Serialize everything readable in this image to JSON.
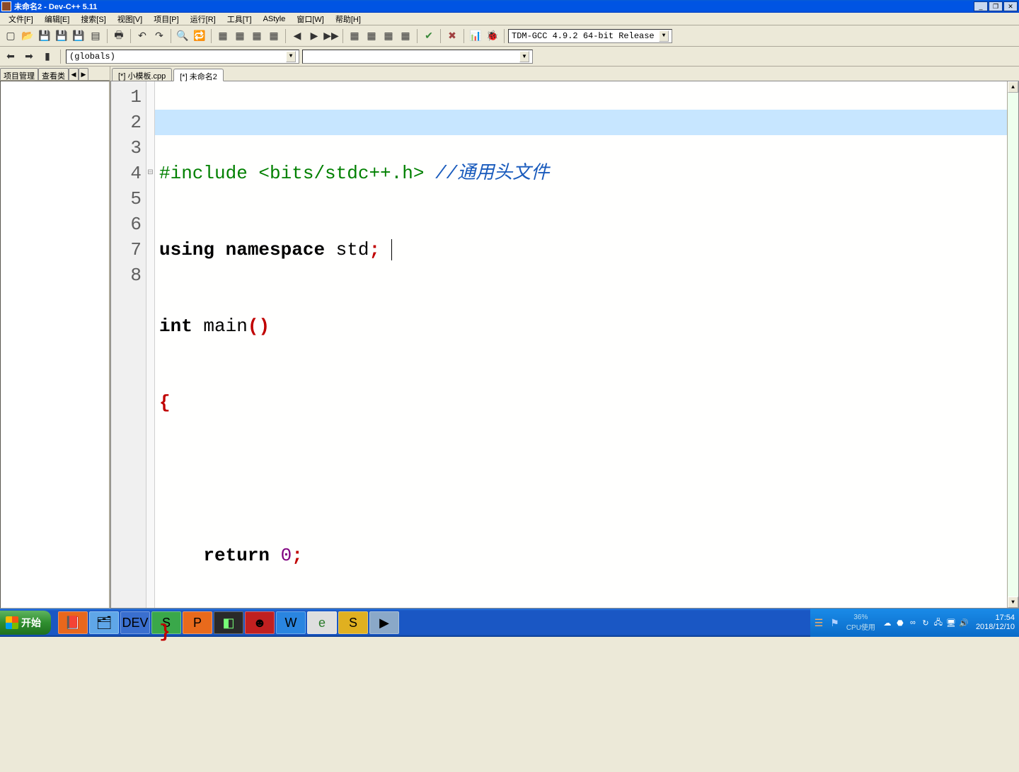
{
  "window": {
    "title": "未命名2 - Dev-C++ 5.11",
    "min": "_",
    "max": "❐",
    "close": "✕"
  },
  "menus": {
    "file": "文件[F]",
    "edit": "编辑[E]",
    "search": "搜索[S]",
    "view": "视图[V]",
    "project": "项目[P]",
    "run": "运行[R]",
    "tools": "工具[T]",
    "astyle": "AStyle",
    "window": "窗口[W]",
    "help": "帮助[H]"
  },
  "compiler": "TDM-GCC 4.9.2 64-bit Release",
  "scope": "(globals)",
  "left_tabs": {
    "proj": "项目管理",
    "classes": "查看类",
    "prev": "◀",
    "next": "▶"
  },
  "editor_tabs": {
    "t1": "[*] 小模板.cpp",
    "t2": "[*] 未命名2"
  },
  "code": {
    "l1_include": "#include",
    "l1_header": " <bits/stdc++.h> ",
    "l1_comment": "//通用头文件",
    "l2_using": "using",
    "l2_namespace": " namespace",
    "l2_std": " std",
    "l2_semicolon": ";",
    "l3_int": "int",
    "l3_space": " ",
    "l3_main": "main",
    "l3_parens": "()",
    "l4_brace": "{",
    "l6_return": "    return",
    "l6_space": " ",
    "l6_zero": "0",
    "l6_semicolon": ";",
    "l7_brace": "}"
  },
  "gutter": {
    "n1": "1",
    "n2": "2",
    "n3": "3",
    "n4": "4",
    "n5": "5",
    "n6": "6",
    "n7": "7",
    "n8": "8"
  },
  "fold": {
    "minus": "⊟"
  },
  "start": "开始",
  "tray": {
    "cpu_pct": "36%",
    "cpu_label": "CPU使用",
    "time": "17:54",
    "date": "2018/12/10"
  }
}
